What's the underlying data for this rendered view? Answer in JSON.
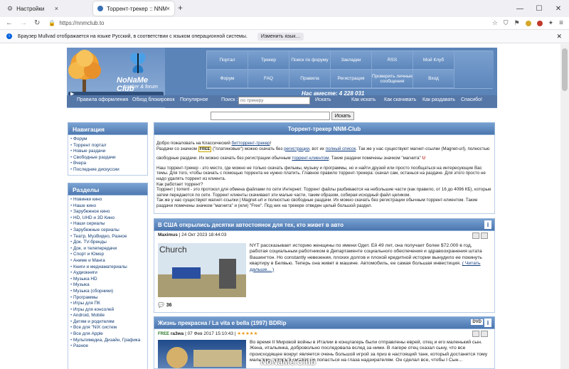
{
  "browser": {
    "tabs": [
      {
        "label": "Настройки"
      },
      {
        "label": "Торрент-трекер :: NNM-Club"
      }
    ],
    "new_tab": "+",
    "url": "https://nnmclub.to",
    "notification": {
      "text": "Браузер Mullvad отображается на языке Русский, в соответствии с языком операционной системы.",
      "button": "Изменить язык…"
    }
  },
  "site": {
    "logo_title": "NoNaMe Club",
    "logo_subtitle": "tracker & forum",
    "menu_row1": [
      "Портал",
      "Трекер",
      "Поиск по форуму",
      "Закладки",
      "RSS",
      "Мой Клуб"
    ],
    "menu_row2": [
      "Форум",
      "FAQ",
      "Правила",
      "Регистрация",
      "Проверить личные сообщения",
      "Вход"
    ],
    "online": "Нас вместе: 4 228 031",
    "subbar": {
      "rules": "Правила оформления",
      "bypass": "Обход блокировок",
      "popular": "Популярное",
      "search_label": "Поиск :",
      "search_placeholder": "по трекеру",
      "search_btn": "Искать",
      "how_search": "Как искать",
      "how_download": "Как скачивать",
      "how_seed": "Как раздавать",
      "thanks": "Спасибо!"
    },
    "main_search_btn": "Искать"
  },
  "nav": {
    "title": "Навигация",
    "items": [
      "Форум",
      "Торрент портал",
      "Новые раздачи",
      "Свободные раздачи",
      "Вчера",
      "Последние дискуссии"
    ]
  },
  "sections": {
    "title": "Разделы",
    "items": [
      "Новинки кино",
      "Наше кино",
      "Зарубежное кино",
      "HD, UHD и 3D Кино",
      "Наши сериалы",
      "Зарубежные сериалы",
      "Театр, МузВидео, Разное",
      "Док. TV-бренды",
      "Док. и телепередачи",
      "Спорт и Юмор",
      "Аниме и Манга",
      "Книги и медиаматериалы",
      "Аудиокниги",
      "Музыка HD",
      "Музыка",
      "Музыка (сборники)",
      "Программы",
      "Игры для ПК",
      "Игры для консолей",
      "Android, Mobile",
      "Детям и родителям",
      "Все для \"NIX систем",
      "Все для Apple",
      "Мультимедиа, Дизайн, Графика",
      "Разное"
    ]
  },
  "intro": {
    "title": "Торрент-трекер NNM-Club",
    "l1a": "Добро пожаловать на Классический ",
    "l1link": "битторрент-трекер",
    "l1b": "!",
    "l2a": "Раздачи со значком ",
    "free_badge": "FREE",
    "l2b": " (\"платиновые\") можно скачать без ",
    "l2link1": "регистрации",
    "l2c": ", вот их ",
    "l2link2": "полный список",
    "l2d": ". Так же у нас существуют магнет-ссылки (Magnet-url), полностью",
    "l3a": "свободные раздачи. Их можно скачать без регистрации обычным ",
    "l3link": "торрент-клиентом",
    "l3b": ". Такие раздачи помечены значком \"магнита\"",
    "p2": "Наш торрент-трекер - это место, где можно не только скачать фильмы, музыку и программы, но и найти друзей или просто пообщаться на интересующие Вас темы. Для того, чтобы скачать с помощью торрента не нужно платить. Главное правило торрент-трекера: скачал сам, останься на раздаче. Для этого просто не надо удалять торрент из клиента.",
    "p3": "Как работает торрент?",
    "p4": "Торрент | torrent - это протокол для обмена файлами по сети Интернет. Торрент файлы разбиваются на небольшие части (как правило, от 16 до 4096 КБ), которые затем передаются по сети. Торрент клиенты скачивают эти малые части, таким образом, собирая исходный файл целиком.",
    "p5": "Так же у нас существуют магнет-ссылки | Magnet-url и полностью свободные раздачи. Их можно скачать без регистрации обычным торрент-клиентом. Такие раздачи помечены значком \"магнита\" и (или) \"Free\". Под них на трекере отведен целый большой раздел."
  },
  "news": {
    "title": "В США открылись десятки автостоянок для тех, кто живет в авто",
    "author": "Maximus",
    "date": " | 24 Окт 2023 18:44:03",
    "image_text": "Church",
    "text": "NYT рассказывает историю женщины по имени Одет. Ей 49 лет, она получает более $72.000 в год, работая социальным работником в Департаменте социального обеспечения и здравоохранения штата Вашингтон. Но constantly невезения, плохих долгов и плохой кредитной истории вынудило ее покинуть квартиру в Белвью. Теперь она живет в машине. Автомобиль, ее самая большая инвестиция.",
    "more": "( Читать дальше... )",
    "comments": "36"
  },
  "release": {
    "title": "Жизнь прекрасна / La vita e bella (1997) BDRip",
    "free": "FREE",
    "author": "ra3wa",
    "date": " | 07 Фев 2017 15:10:43 | ",
    "stars": "★★★★★",
    "dvd_badge": "DVD",
    "text": "Во время II Мировой войны в Италии в концлагерь были отправлены еврей, отец и его маленький сын. Жена, итальянка, добровольно последовала вслед за ними. В лагере отец сказал сыну, что все происходящее вокруг является очень большой игрой за приз в настоящий танк, который достанется тому мальчику, который сможет не попасться на глаза надзирателям. Он сделал все, чтобы І Сын..."
  },
  "watermark": "NoNaMe.Club"
}
